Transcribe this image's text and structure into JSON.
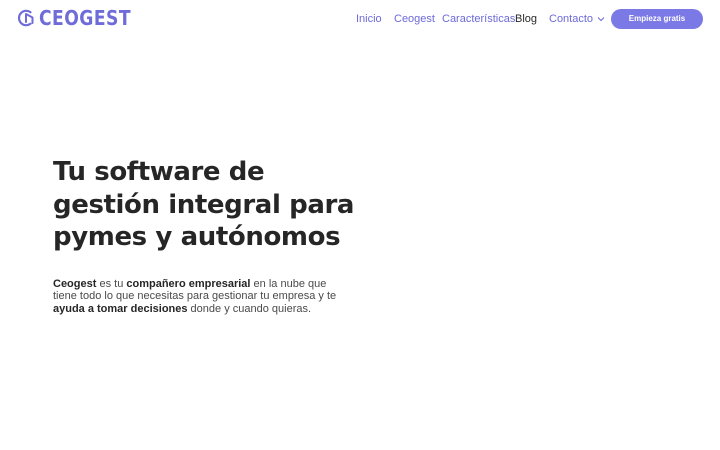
{
  "brand": {
    "name": "CEOGEST",
    "color": "#6f6cd9"
  },
  "nav": {
    "items": [
      {
        "label": "Inicio"
      },
      {
        "label": "Ceogest"
      },
      {
        "label": "Características"
      },
      {
        "label": "Blog"
      },
      {
        "label": "Contacto"
      }
    ],
    "cta_label": "Empieza gratis",
    "accent": "#7b79e6",
    "contact_icon": "chevron-down-icon"
  },
  "hero": {
    "title": "Tu software de gestión integral para pymes y autónomos",
    "text": [
      {
        "t": "Ceogest",
        "b": true
      },
      {
        "t": " es tu ",
        "b": false
      },
      {
        "t": "compañero empresarial",
        "b": true
      },
      {
        "t": " en la nube que tiene todo lo que necesitas para gestionar tu empresa y te ",
        "b": false
      },
      {
        "t": "ayuda a tomar decisiones",
        "b": true
      },
      {
        "t": " donde y cuando quieras.",
        "b": false
      }
    ]
  }
}
